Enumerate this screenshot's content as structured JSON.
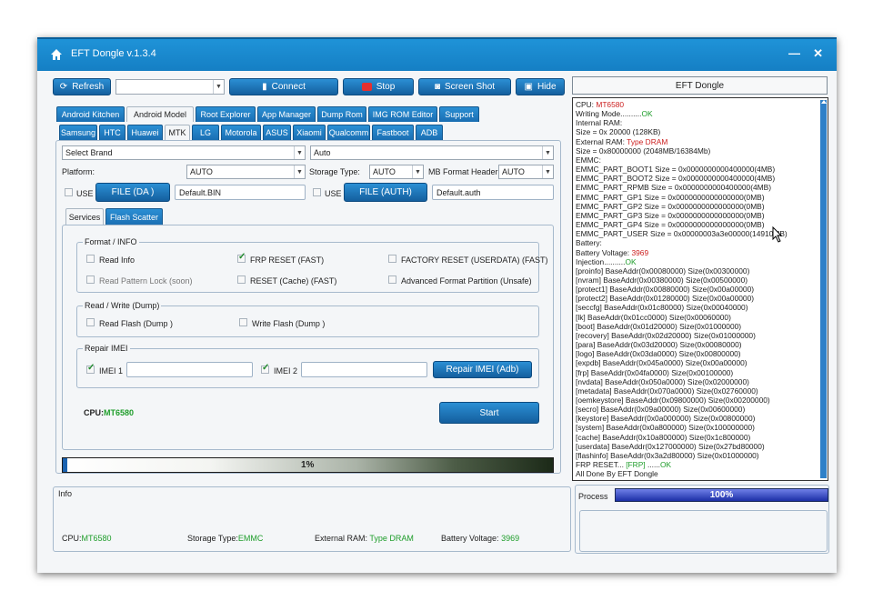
{
  "window": {
    "title": "EFT Dongle  v.1.3.4"
  },
  "toolbar": {
    "refresh": "Refresh",
    "port_value": "",
    "connect": "Connect",
    "stop": "Stop",
    "screenshot": "Screen Shot",
    "hide": "Hide"
  },
  "main_tabs": [
    "Android Kitchen",
    "Android Model",
    "Root Explorer",
    "App Manager",
    "Dump Rom",
    "IMG ROM Editor",
    "Support"
  ],
  "brand_tabs": [
    "Samsung",
    "HTC",
    "Huawei",
    "MTK",
    "LG",
    "Motorola",
    "ASUS",
    "Xiaomi",
    "Qualcomm",
    "Fastboot",
    "ADB"
  ],
  "config": {
    "select_brand": "Select Brand",
    "auto_select": "Auto",
    "platform_label": "Platform:",
    "platform_value": "AUTO",
    "storage_label": "Storage Type:",
    "storage_value": "AUTO",
    "mb_label": "MB Format Header",
    "mb_value": "AUTO",
    "use_label": "USE",
    "file_da": "FILE (DA )",
    "file_da_value": "Default.BIN",
    "use_label2": "USE",
    "file_auth": "FILE (AUTH)",
    "file_auth_value": "Default.auth"
  },
  "sub_tabs": [
    "Services",
    "Flash Scatter"
  ],
  "format_info": {
    "legend": "Format / INFO",
    "read_info": "Read Info",
    "frp_reset": "FRP RESET (FAST)",
    "factory_reset": "FACTORY RESET (USERDATA) (FAST)",
    "read_pattern": "Read Pattern Lock (soon)",
    "reset_cache": "RESET (Cache) (FAST)",
    "adv_format": "Advanced Format Partition (Unsafe)"
  },
  "read_write": {
    "legend": "Read / Write (Dump)",
    "read_flash": "Read Flash (Dump )",
    "write_flash": "Write Flash (Dump )"
  },
  "repair_imei": {
    "legend": "Repair IMEI",
    "imei1": "IMEI 1",
    "imei1_value": "",
    "imei2": "IMEI 2",
    "imei2_value": "",
    "button": "Repair IMEI (Adb)"
  },
  "cpu_line": {
    "label": "CPU:",
    "value": "MT6580"
  },
  "start_button": "Start",
  "progress": {
    "label": "1%",
    "fraction": 0.01
  },
  "info": {
    "title": "Info",
    "cpu_label": "CPU:",
    "cpu_value": "MT6580",
    "storage_label": "Storage Type:",
    "storage_value": "EMMC",
    "ram_label": "External RAM:",
    "ram_value": "Type DRAM",
    "battery_label": "Battery Voltage:",
    "battery_value": "3969"
  },
  "right_panel": {
    "header": "EFT Dongle",
    "process_label": "Process",
    "process_text": "100%",
    "process_fraction": 1.0
  },
  "log": [
    {
      "t": "CPU: ",
      "v": "MT6580",
      "c": "r"
    },
    {
      "t": "Writing Mode..........",
      "v": "OK",
      "c": "g"
    },
    {
      "t": "Internal RAM:"
    },
    {
      "t": "Size = 0x 20000 (128KB)"
    },
    {
      "t": "External RAM: ",
      "v": "Type DRAM",
      "c": "r"
    },
    {
      "t": "Size = 0x80000000 (2048MB/16384Mb)"
    },
    {
      "t": "EMMC:"
    },
    {
      "t": "EMMC_PART_BOOT1 Size = 0x0000000000400000(4MB)"
    },
    {
      "t": "EMMC_PART_BOOT2 Size = 0x0000000000400000(4MB)"
    },
    {
      "t": "EMMC_PART_RPMB Size = 0x0000000000400000(4MB)"
    },
    {
      "t": "EMMC_PART_GP1 Size = 0x0000000000000000(0MB)"
    },
    {
      "t": "EMMC_PART_GP2 Size = 0x0000000000000000(0MB)"
    },
    {
      "t": "EMMC_PART_GP3 Size = 0x0000000000000000(0MB)"
    },
    {
      "t": "EMMC_PART_GP4 Size = 0x0000000000000000(0MB)"
    },
    {
      "t": "EMMC_PART_USER Size = 0x00000003a3e00000(14910MB)"
    },
    {
      "t": "Battery:"
    },
    {
      "t": "Battery Voltage: ",
      "v": "3969",
      "c": "r"
    },
    {
      "t": "Injection..........",
      "v": "OK",
      "c": "g"
    },
    {
      "t": "[proinfo] BaseAddr(0x00080000) Size(0x00300000)"
    },
    {
      "t": "[nvram] BaseAddr(0x00380000) Size(0x00500000)"
    },
    {
      "t": "[protect1] BaseAddr(0x00880000) Size(0x00a00000)"
    },
    {
      "t": "[protect2] BaseAddr(0x01280000) Size(0x00a00000)"
    },
    {
      "t": "[seccfg] BaseAddr(0x01c80000) Size(0x00040000)"
    },
    {
      "t": "[lk] BaseAddr(0x01cc0000) Size(0x00060000)"
    },
    {
      "t": "[boot] BaseAddr(0x01d20000) Size(0x01000000)"
    },
    {
      "t": "[recovery] BaseAddr(0x02d20000) Size(0x01000000)"
    },
    {
      "t": "[para] BaseAddr(0x03d20000) Size(0x00080000)"
    },
    {
      "t": "[logo] BaseAddr(0x03da0000) Size(0x00800000)"
    },
    {
      "t": "[expdb] BaseAddr(0x045a0000) Size(0x00a00000)"
    },
    {
      "t": "[frp] BaseAddr(0x04fa0000) Size(0x00100000)"
    },
    {
      "t": "[nvdata] BaseAddr(0x050a0000) Size(0x02000000)"
    },
    {
      "t": "[metadata] BaseAddr(0x070a0000) Size(0x02760000)"
    },
    {
      "t": "[oemkeystore] BaseAddr(0x09800000) Size(0x00200000)"
    },
    {
      "t": "[secro] BaseAddr(0x09a00000) Size(0x00600000)"
    },
    {
      "t": "[keystore] BaseAddr(0x0a000000) Size(0x00800000)"
    },
    {
      "t": "[system] BaseAddr(0x0a800000) Size(0x100000000)"
    },
    {
      "t": "[cache] BaseAddr(0x10a800000) Size(0x1c800000)"
    },
    {
      "t": "[userdata] BaseAddr(0x127000000) Size(0x27bd80000)"
    },
    {
      "t": "[flashinfo] BaseAddr(0x3a2d80000) Size(0x01000000)"
    },
    {
      "t": "FRP RESET... ",
      "v": "[FRP]",
      "c": "g",
      "t2": " ......",
      "v2": "OK",
      "c2": "g"
    },
    {
      "t": "All Done By EFT Dongle"
    }
  ],
  "colors": {
    "title_bar": "#1a88d0",
    "button": "#1f78c0",
    "ok_green": "#1e9d2a",
    "value_red": "#cc2020"
  }
}
